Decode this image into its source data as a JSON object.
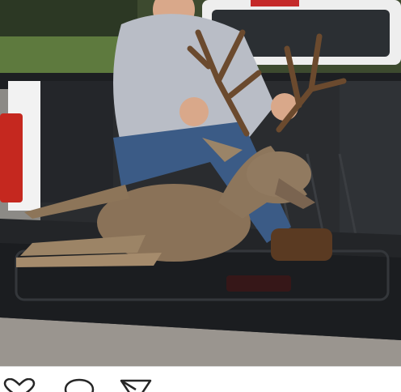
{
  "post": {
    "image_icon": "photo-of-hunter-with-deer-on-truck-tailgate"
  },
  "actions": {
    "like_icon": "heart-icon",
    "comment_icon": "comment-bubble-icon",
    "share_icon": "paper-plane-icon"
  },
  "colors": {
    "background": "#ffffff",
    "icon_stroke": "#262626",
    "divider": "#dbdbdb"
  }
}
